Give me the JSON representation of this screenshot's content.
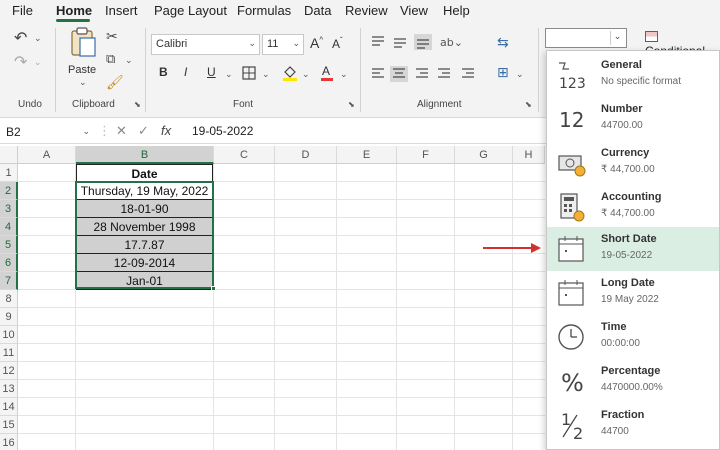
{
  "menu": {
    "items": [
      "File",
      "Home",
      "Insert",
      "Page Layout",
      "Formulas",
      "Data",
      "Review",
      "View",
      "Help"
    ],
    "active": "Home"
  },
  "ribbon": {
    "groups": {
      "undo": "Undo",
      "clipboard": "Clipboard",
      "font": "Font",
      "alignment": "Alignment"
    },
    "paste_label": "Paste",
    "font_name": "Calibri",
    "font_size": "11",
    "bold": "B",
    "italic": "I",
    "underline": "U",
    "conditional_label": "Conditional"
  },
  "formula_bar": {
    "name_box": "B2",
    "fx": "fx",
    "value": "19-05-2022"
  },
  "sheet": {
    "columns": [
      "A",
      "B",
      "C",
      "D",
      "E",
      "F",
      "G",
      "H"
    ],
    "rows": [
      "1",
      "2",
      "3",
      "4",
      "5",
      "6",
      "7",
      "8",
      "9",
      "10",
      "11",
      "12",
      "13",
      "14",
      "15",
      "16"
    ],
    "cells": [
      "Date",
      "Thursday, 19 May, 2022",
      "18-01-90",
      "28 November 1998",
      "17.7.87",
      "12-09-2014",
      "Jan-01"
    ]
  },
  "number_formats": [
    {
      "title": "General",
      "sub": "No specific format",
      "icon": "general-icon"
    },
    {
      "title": "Number",
      "sub": "44700.00",
      "icon": "number-icon"
    },
    {
      "title": "Currency",
      "sub": "₹ 44,700.00",
      "icon": "currency-icon"
    },
    {
      "title": "Accounting",
      "sub": "₹ 44,700.00",
      "icon": "accounting-icon"
    },
    {
      "title": "Short Date",
      "sub": "19-05-2022",
      "icon": "short-date-icon"
    },
    {
      "title": "Long Date",
      "sub": "19 May 2022",
      "icon": "long-date-icon"
    },
    {
      "title": "Time",
      "sub": "00:00:00",
      "icon": "clock-icon"
    },
    {
      "title": "Percentage",
      "sub": "4470000.00%",
      "icon": "percent-icon"
    },
    {
      "title": "Fraction",
      "sub": "44700",
      "icon": "fraction-icon"
    }
  ],
  "icon_glyphs": {
    "number": "12",
    "percent": "%",
    "fraction_top": "1",
    "fraction_bottom": "2",
    "general": "123"
  },
  "colors": {
    "accent": "#217346",
    "highlight": "#dbeee3",
    "arrow": "#d32f2f"
  }
}
